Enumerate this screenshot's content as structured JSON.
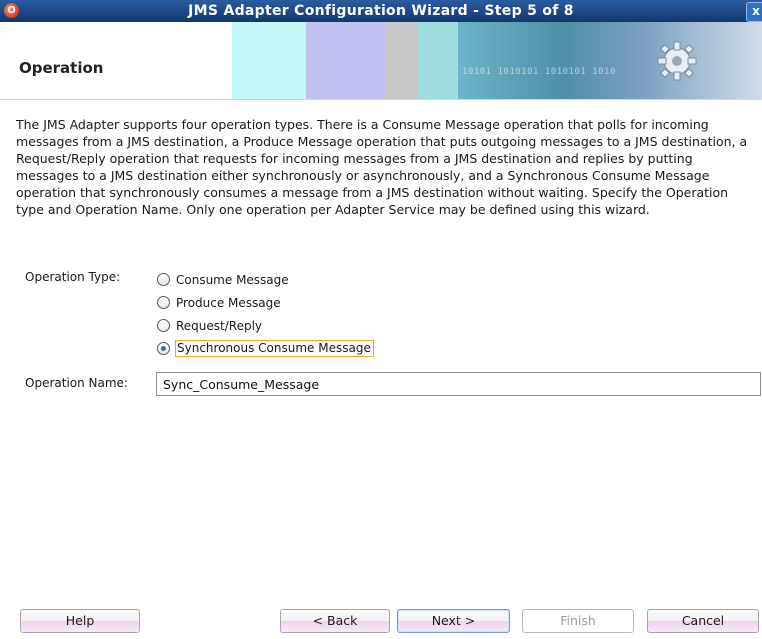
{
  "window": {
    "title": "JMS Adapter Configuration Wizard - Step 5 of 8",
    "app_icon": "oracle-jdeveloper-icon",
    "close_glyph": "x"
  },
  "banner": {
    "heading": "Operation",
    "binary": "10101 1010101  1010101   1010"
  },
  "description": "The JMS Adapter supports four operation types.  There is a Consume Message operation that polls for incoming messages from a JMS destination, a Produce Message operation that puts outgoing messages to a JMS destination, a Request/Reply operation that requests for incoming messages from a JMS destination and replies by putting messages to a JMS destination either synchronously or asynchronously, and a Synchronous Consume Message operation that synchronously consumes a message from a JMS destination without waiting.  Specify the Operation type and Operation Name.  Only one operation per Adapter Service may be defined using this wizard.",
  "operation_type": {
    "label": "Operation Type:",
    "options": [
      {
        "label": "Consume Message",
        "checked": false
      },
      {
        "label": "Produce Message",
        "checked": false
      },
      {
        "label": "Request/Reply",
        "checked": false
      },
      {
        "label": "Synchronous Consume Message",
        "checked": true
      }
    ]
  },
  "operation_name": {
    "label": "Operation Name:",
    "value": "Sync_Consume_Message"
  },
  "buttons": {
    "help": "Help",
    "back": "< Back",
    "next": "Next >",
    "finish": "Finish",
    "cancel": "Cancel"
  },
  "colors": {
    "titlebar": "#1f4f8f",
    "focus_outline": "#f2a13a",
    "radio_dot": "#3d6ab5"
  }
}
